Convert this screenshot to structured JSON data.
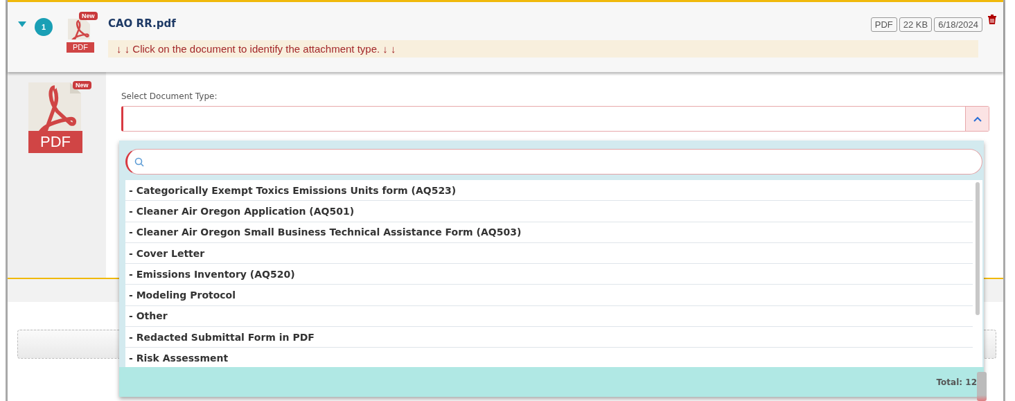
{
  "file": {
    "expanded": true,
    "number": "1",
    "badge": "New",
    "icon_label": "PDF",
    "name": "CAO RR.pdf",
    "hint": "↓ ↓ Click on the document to identify the attachment type. ↓ ↓",
    "tags": [
      "PDF",
      "22 KB",
      "6/18/2024"
    ]
  },
  "preview": {
    "badge": "New",
    "icon_label": "PDF"
  },
  "document_type": {
    "label": "Select Document Type:",
    "open": true,
    "total": "Total: 12",
    "options": [
      {
        "label": "- Categorically Exempt Toxics Emissions Units form (AQ523)",
        "selected": false
      },
      {
        "label": "- Cleaner Air Oregon Application (AQ501)",
        "selected": false
      },
      {
        "label": "- Cleaner Air Oregon Small Business Technical Assistance Form (AQ503)",
        "selected": false
      },
      {
        "label": "- Cover Letter",
        "selected": false
      },
      {
        "label": "- Emissions Inventory (AQ520)",
        "selected": false
      },
      {
        "label": "- Modeling Protocol",
        "selected": false
      },
      {
        "label": "- Other",
        "selected": false
      },
      {
        "label": "- Redacted Submittal Form in PDF",
        "selected": false
      },
      {
        "label": "- Risk Assessment",
        "selected": false
      }
    ]
  }
}
